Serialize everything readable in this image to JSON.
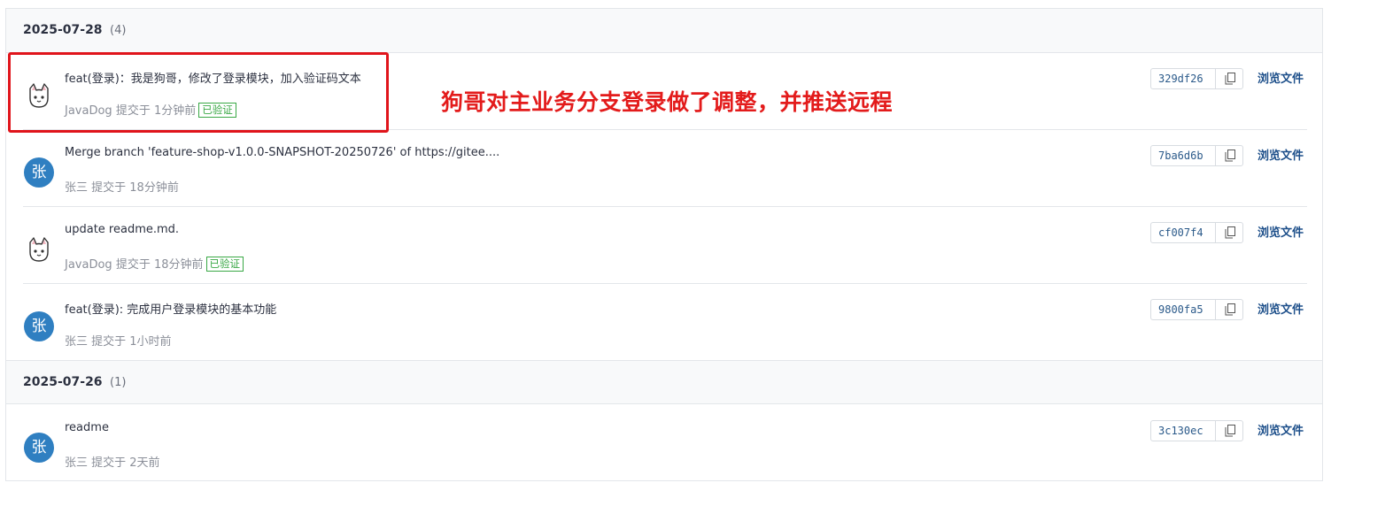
{
  "groups": [
    {
      "date": "2025-07-28",
      "count": "(4)",
      "commits": [
        {
          "avatar": "cat",
          "message": "feat(登录)：我是狗哥，修改了登录模块，加入验证码文本",
          "author": "JavaDog",
          "time": "提交于 1分钟前",
          "verified": "已验证",
          "sha": "329df26",
          "browse": "浏览文件"
        },
        {
          "avatar": "张",
          "message": "Merge branch 'feature-shop-v1.0.0-SNAPSHOT-20250726' of https://gitee....",
          "author": "张三",
          "time": "提交于 18分钟前",
          "verified": "",
          "sha": "7ba6d6b",
          "browse": "浏览文件"
        },
        {
          "avatar": "cat",
          "message": "update readme.md.",
          "author": "JavaDog",
          "time": "提交于 18分钟前",
          "verified": "已验证",
          "sha": "cf007f4",
          "browse": "浏览文件"
        },
        {
          "avatar": "张",
          "message": "feat(登录): 完成用户登录模块的基本功能",
          "author": "张三",
          "time": "提交于 1小时前",
          "verified": "",
          "sha": "9800fa5",
          "browse": "浏览文件"
        }
      ]
    },
    {
      "date": "2025-07-26",
      "count": "(1)",
      "commits": [
        {
          "avatar": "张",
          "message": "readme",
          "author": "张三",
          "time": "提交于 2天前",
          "verified": "",
          "sha": "3c130ec",
          "browse": "浏览文件"
        }
      ]
    }
  ],
  "annotation": "狗哥对主业务分支登录做了调整，并推送远程",
  "icons": {
    "copy": "copy-icon",
    "cat_avatar": "cat-avatar-icon"
  },
  "colors": {
    "annotation": "#e31b1b",
    "verified": "#39a845",
    "avatar_bg": "#2f7fc1",
    "link": "#1d4f8a"
  }
}
